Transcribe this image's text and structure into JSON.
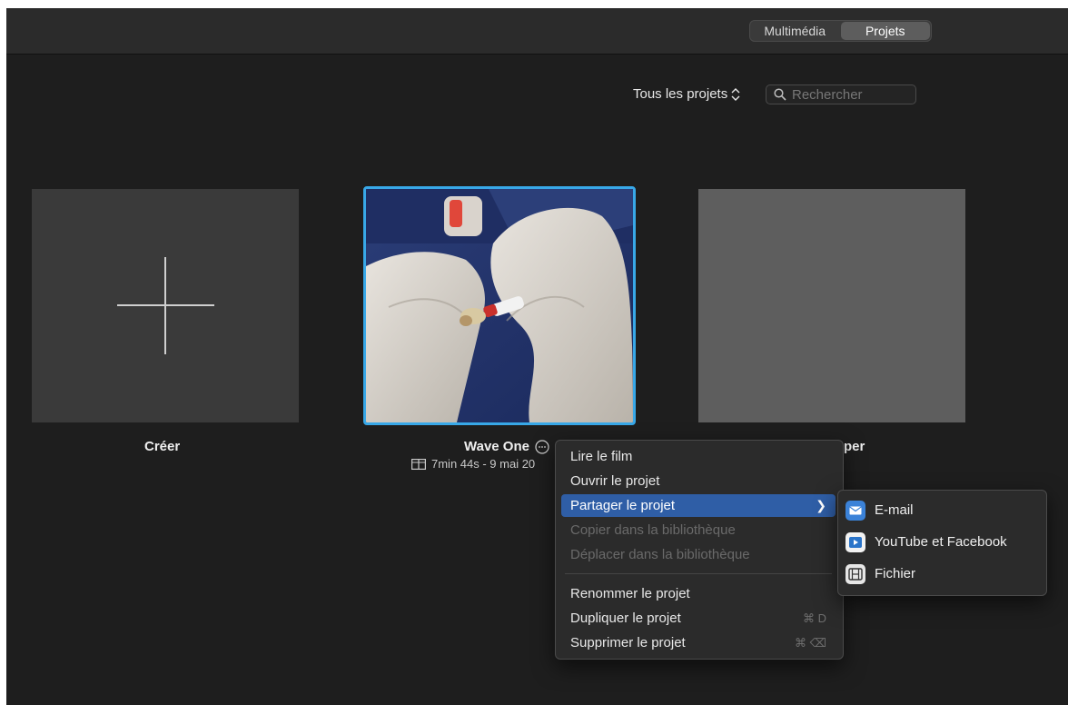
{
  "toolbar": {
    "tabs": [
      {
        "label": "Multimédia",
        "active": false
      },
      {
        "label": "Projets",
        "active": true
      }
    ]
  },
  "filter": {
    "label": "Tous les projets",
    "icon": "chevron-updown-icon"
  },
  "search": {
    "placeholder": "Rechercher",
    "value": ""
  },
  "projects": [
    {
      "title": "Créer",
      "icon": "plus-icon"
    },
    {
      "title": "Wave One",
      "meta": "7min 44s - 9 mai 20",
      "selected": true
    },
    {
      "title": "per",
      "meta": ""
    }
  ],
  "context_menu": {
    "items": [
      {
        "label": "Lire le film",
        "enabled": true
      },
      {
        "label": "Ouvrir le projet",
        "enabled": true
      },
      {
        "label": "Partager le projet",
        "enabled": true,
        "highlighted": true,
        "submenu": true
      },
      {
        "label": "Copier dans la bibliothèque",
        "enabled": false
      },
      {
        "label": "Déplacer dans la bibliothèque",
        "enabled": false
      },
      {
        "label": "Renommer le projet",
        "enabled": true
      },
      {
        "label": "Dupliquer le projet",
        "enabled": true,
        "shortcut": "⌘ D"
      },
      {
        "label": "Supprimer le projet",
        "enabled": true,
        "shortcut": "⌘ ⌫"
      }
    ]
  },
  "share_submenu": {
    "items": [
      {
        "label": "E-mail",
        "icon": "mail-icon",
        "color": "#3b82d8"
      },
      {
        "label": "YouTube et Facebook",
        "icon": "media-share-icon",
        "color": "#2a74c9"
      },
      {
        "label": "Fichier",
        "icon": "film-file-icon",
        "color": "#6b6b6b"
      }
    ]
  },
  "colors": {
    "selection": "#38a8e8",
    "menu_highlight": "#2f5ea6"
  }
}
